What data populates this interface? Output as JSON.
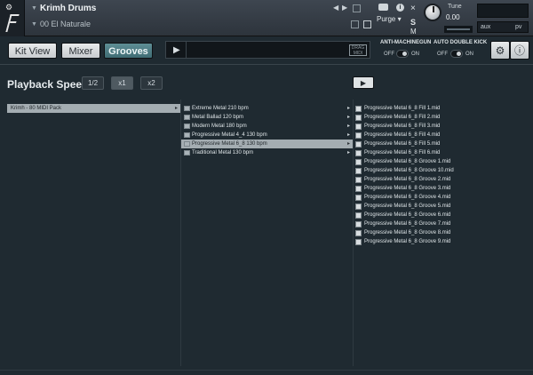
{
  "header": {
    "instrument_name": "Krimh Drums",
    "snapshot_name": "00 El Naturale",
    "purge_label": "Purge",
    "tune_label": "Tune",
    "tune_value": "0.00",
    "close_label": "×",
    "solo_label": "S",
    "mute_label": "M",
    "aux_label": "aux",
    "pv_label": "pv",
    "info_label": "i"
  },
  "tabs": [
    {
      "label": "Kit View"
    },
    {
      "label": "Mixer"
    },
    {
      "label": "Grooves"
    }
  ],
  "transport": {
    "drag_label": "DRAG MIDI"
  },
  "switches": {
    "anti_machinegun": {
      "label": "ANTI-MACHINEGUN",
      "off": "OFF",
      "on": "ON"
    },
    "auto_double_kick": {
      "label": "AUTO DOUBLE KICK",
      "off": "OFF",
      "on": "ON"
    }
  },
  "playback": {
    "title": "Playback Speed",
    "options": [
      "1/2",
      "x1",
      "x2"
    ],
    "selected": "x1"
  },
  "browser": {
    "packs": [
      "Krimh - 80 MIDI Pack"
    ],
    "categories": [
      "Extreme Metal 210 bpm",
      "Metal Ballad 120 bpm",
      "Modern Metal 180 bpm",
      "Progressive Metal 4_4 130 bpm",
      "Progressive Metal 6_8 130 bpm",
      "Traditional Metal 130 bpm"
    ],
    "selected_category": "Progressive Metal 6_8 130 bpm",
    "files": [
      "Progressive Metal 6_8 Fill 1.mid",
      "Progressive Metal 6_8 Fill 2.mid",
      "Progressive Metal 6_8 Fill 3.mid",
      "Progressive Metal 6_8 Fill 4.mid",
      "Progressive Metal 6_8 Fill 5.mid",
      "Progressive Metal 6_8 Fill 6.mid",
      "Progressive Metal 6_8 Groove 1.mid",
      "Progressive Metal 6_8 Groove 10.mid",
      "Progressive Metal 6_8 Groove 2.mid",
      "Progressive Metal 6_8 Groove 3.mid",
      "Progressive Metal 6_8 Groove 4.mid",
      "Progressive Metal 6_8 Groove 5.mid",
      "Progressive Metal 6_8 Groove 6.mid",
      "Progressive Metal 6_8 Groove 7.mid",
      "Progressive Metal 6_8 Groove 8.mid",
      "Progressive Metal 6_8 Groove 9.mid"
    ]
  },
  "colors": {
    "background": "#1f2a31",
    "accent_tab": "#4f7d84",
    "selection": "#a4adb2"
  }
}
